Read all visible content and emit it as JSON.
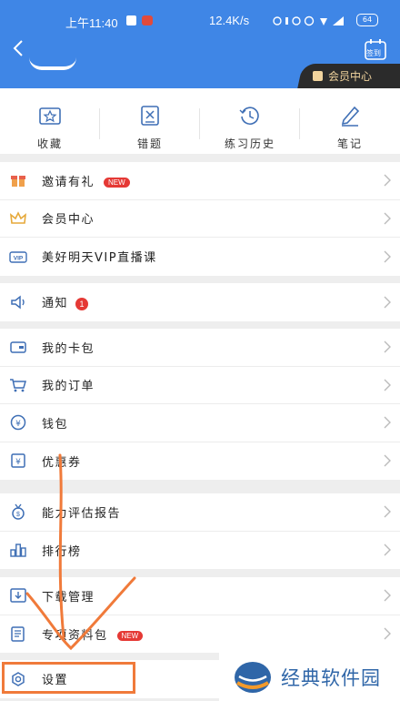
{
  "statusbar": {
    "time": "上午11:40",
    "net_speed": "12.4K/s",
    "battery": "64"
  },
  "header": {
    "signin_label": "签到",
    "vip_banner": "会员中心"
  },
  "quick_actions": [
    {
      "label": "收藏",
      "icon": "star-box-icon"
    },
    {
      "label": "错题",
      "icon": "wrong-box-icon"
    },
    {
      "label": "练习历史",
      "icon": "history-clock-icon"
    },
    {
      "label": "笔记",
      "icon": "pen-icon"
    }
  ],
  "menu_groups": [
    [
      {
        "label": "邀请有礼",
        "icon": "gift-icon",
        "badge": "NEW"
      },
      {
        "label": "会员中心",
        "icon": "crown-icon"
      },
      {
        "label": "美好明天VIP直播课",
        "icon": "vip-icon"
      }
    ],
    [
      {
        "label": "通知",
        "icon": "speaker-icon",
        "count": "1"
      }
    ],
    [
      {
        "label": "我的卡包",
        "icon": "wallet-card-icon"
      },
      {
        "label": "我的订单",
        "icon": "cart-icon"
      },
      {
        "label": "钱包",
        "icon": "yen-coin-icon"
      },
      {
        "label": "优惠券",
        "icon": "coupon-icon"
      }
    ],
    [
      {
        "label": "能力评估报告",
        "icon": "medal-icon"
      },
      {
        "label": "排行榜",
        "icon": "ranking-icon"
      }
    ],
    [
      {
        "label": "下载管理",
        "icon": "download-icon"
      },
      {
        "label": "专项资料包",
        "icon": "document-pack-icon",
        "badge": "NEW"
      }
    ],
    [
      {
        "label": "设置",
        "icon": "settings-icon"
      }
    ]
  ],
  "watermark": {
    "text": "经典软件园"
  },
  "colors": {
    "header_blue": "#3f86e6",
    "badge_red": "#e53935",
    "annotation_orange": "#f07a3a",
    "vip_gold": "#f1d49e"
  }
}
